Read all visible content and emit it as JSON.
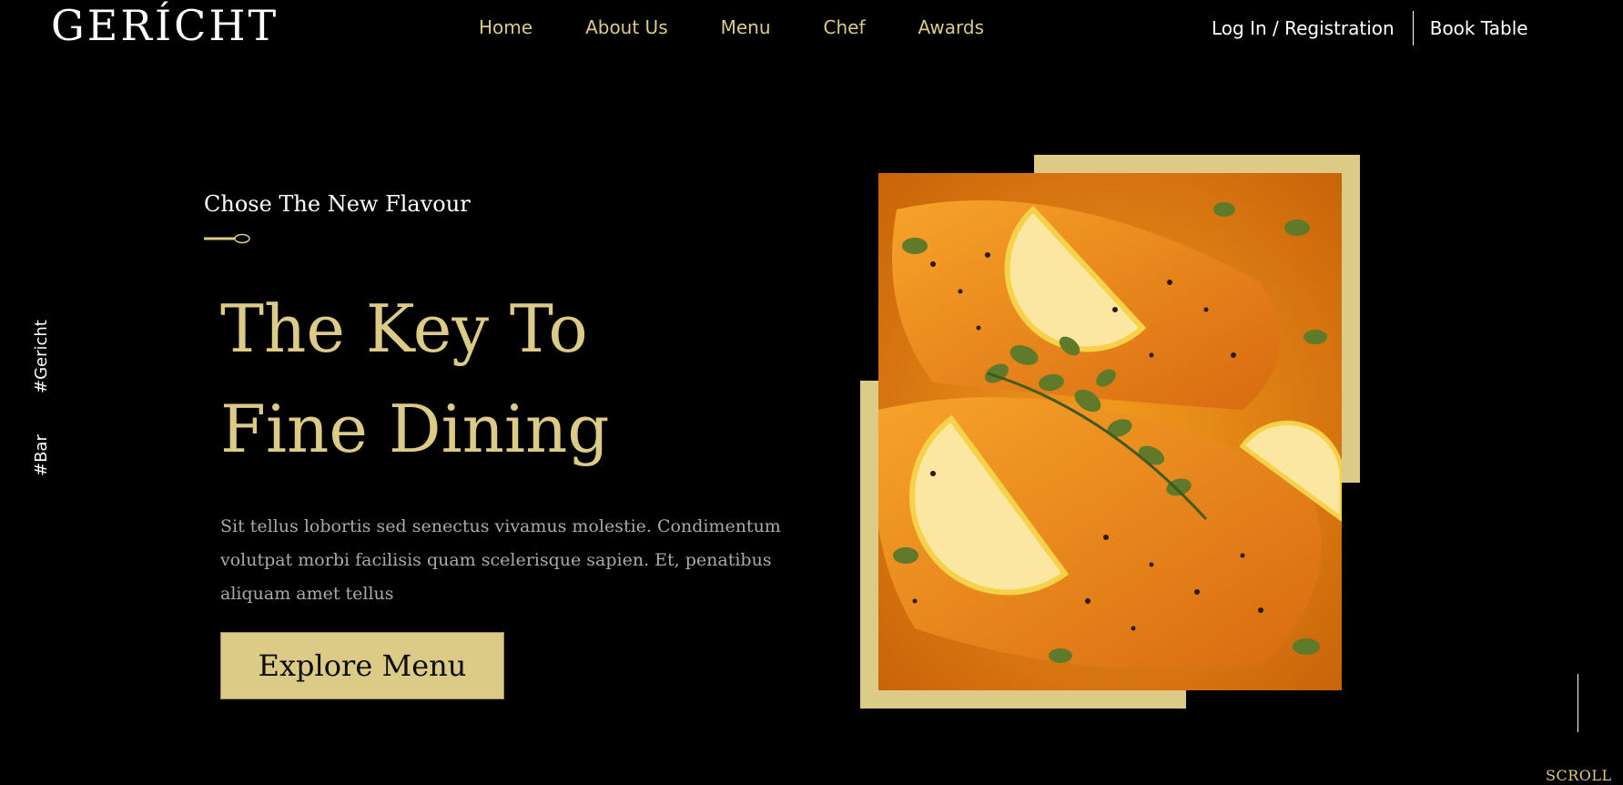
{
  "brand": {
    "logo": "GERÍCHT"
  },
  "nav": {
    "links": [
      "Home",
      "About Us",
      "Menu",
      "Chef",
      "Awards"
    ],
    "login_label": "Log In / Registration",
    "book_label": "Book Table"
  },
  "side_tags": [
    "#Gericht",
    "#Bar"
  ],
  "hero": {
    "subtitle": "Chose The New Flavour",
    "title_line1": "The Key To",
    "title_line2": "Fine Dining",
    "description": "Sit tellus lobortis sed senectus vivamus molestie. Condimentum volutpat morbi facilisis quam scelerisque sapien. Et, penatibus aliquam amet tellus",
    "button_label": "Explore Menu"
  },
  "scroll_label": "SCROLL",
  "colors": {
    "accent": "#DCCA87",
    "background": "#000000",
    "text": "#FFFFFF",
    "muted_text": "#AAAAAA"
  },
  "image": {
    "subject": "salmon fillets with lemon slices and herbs"
  }
}
